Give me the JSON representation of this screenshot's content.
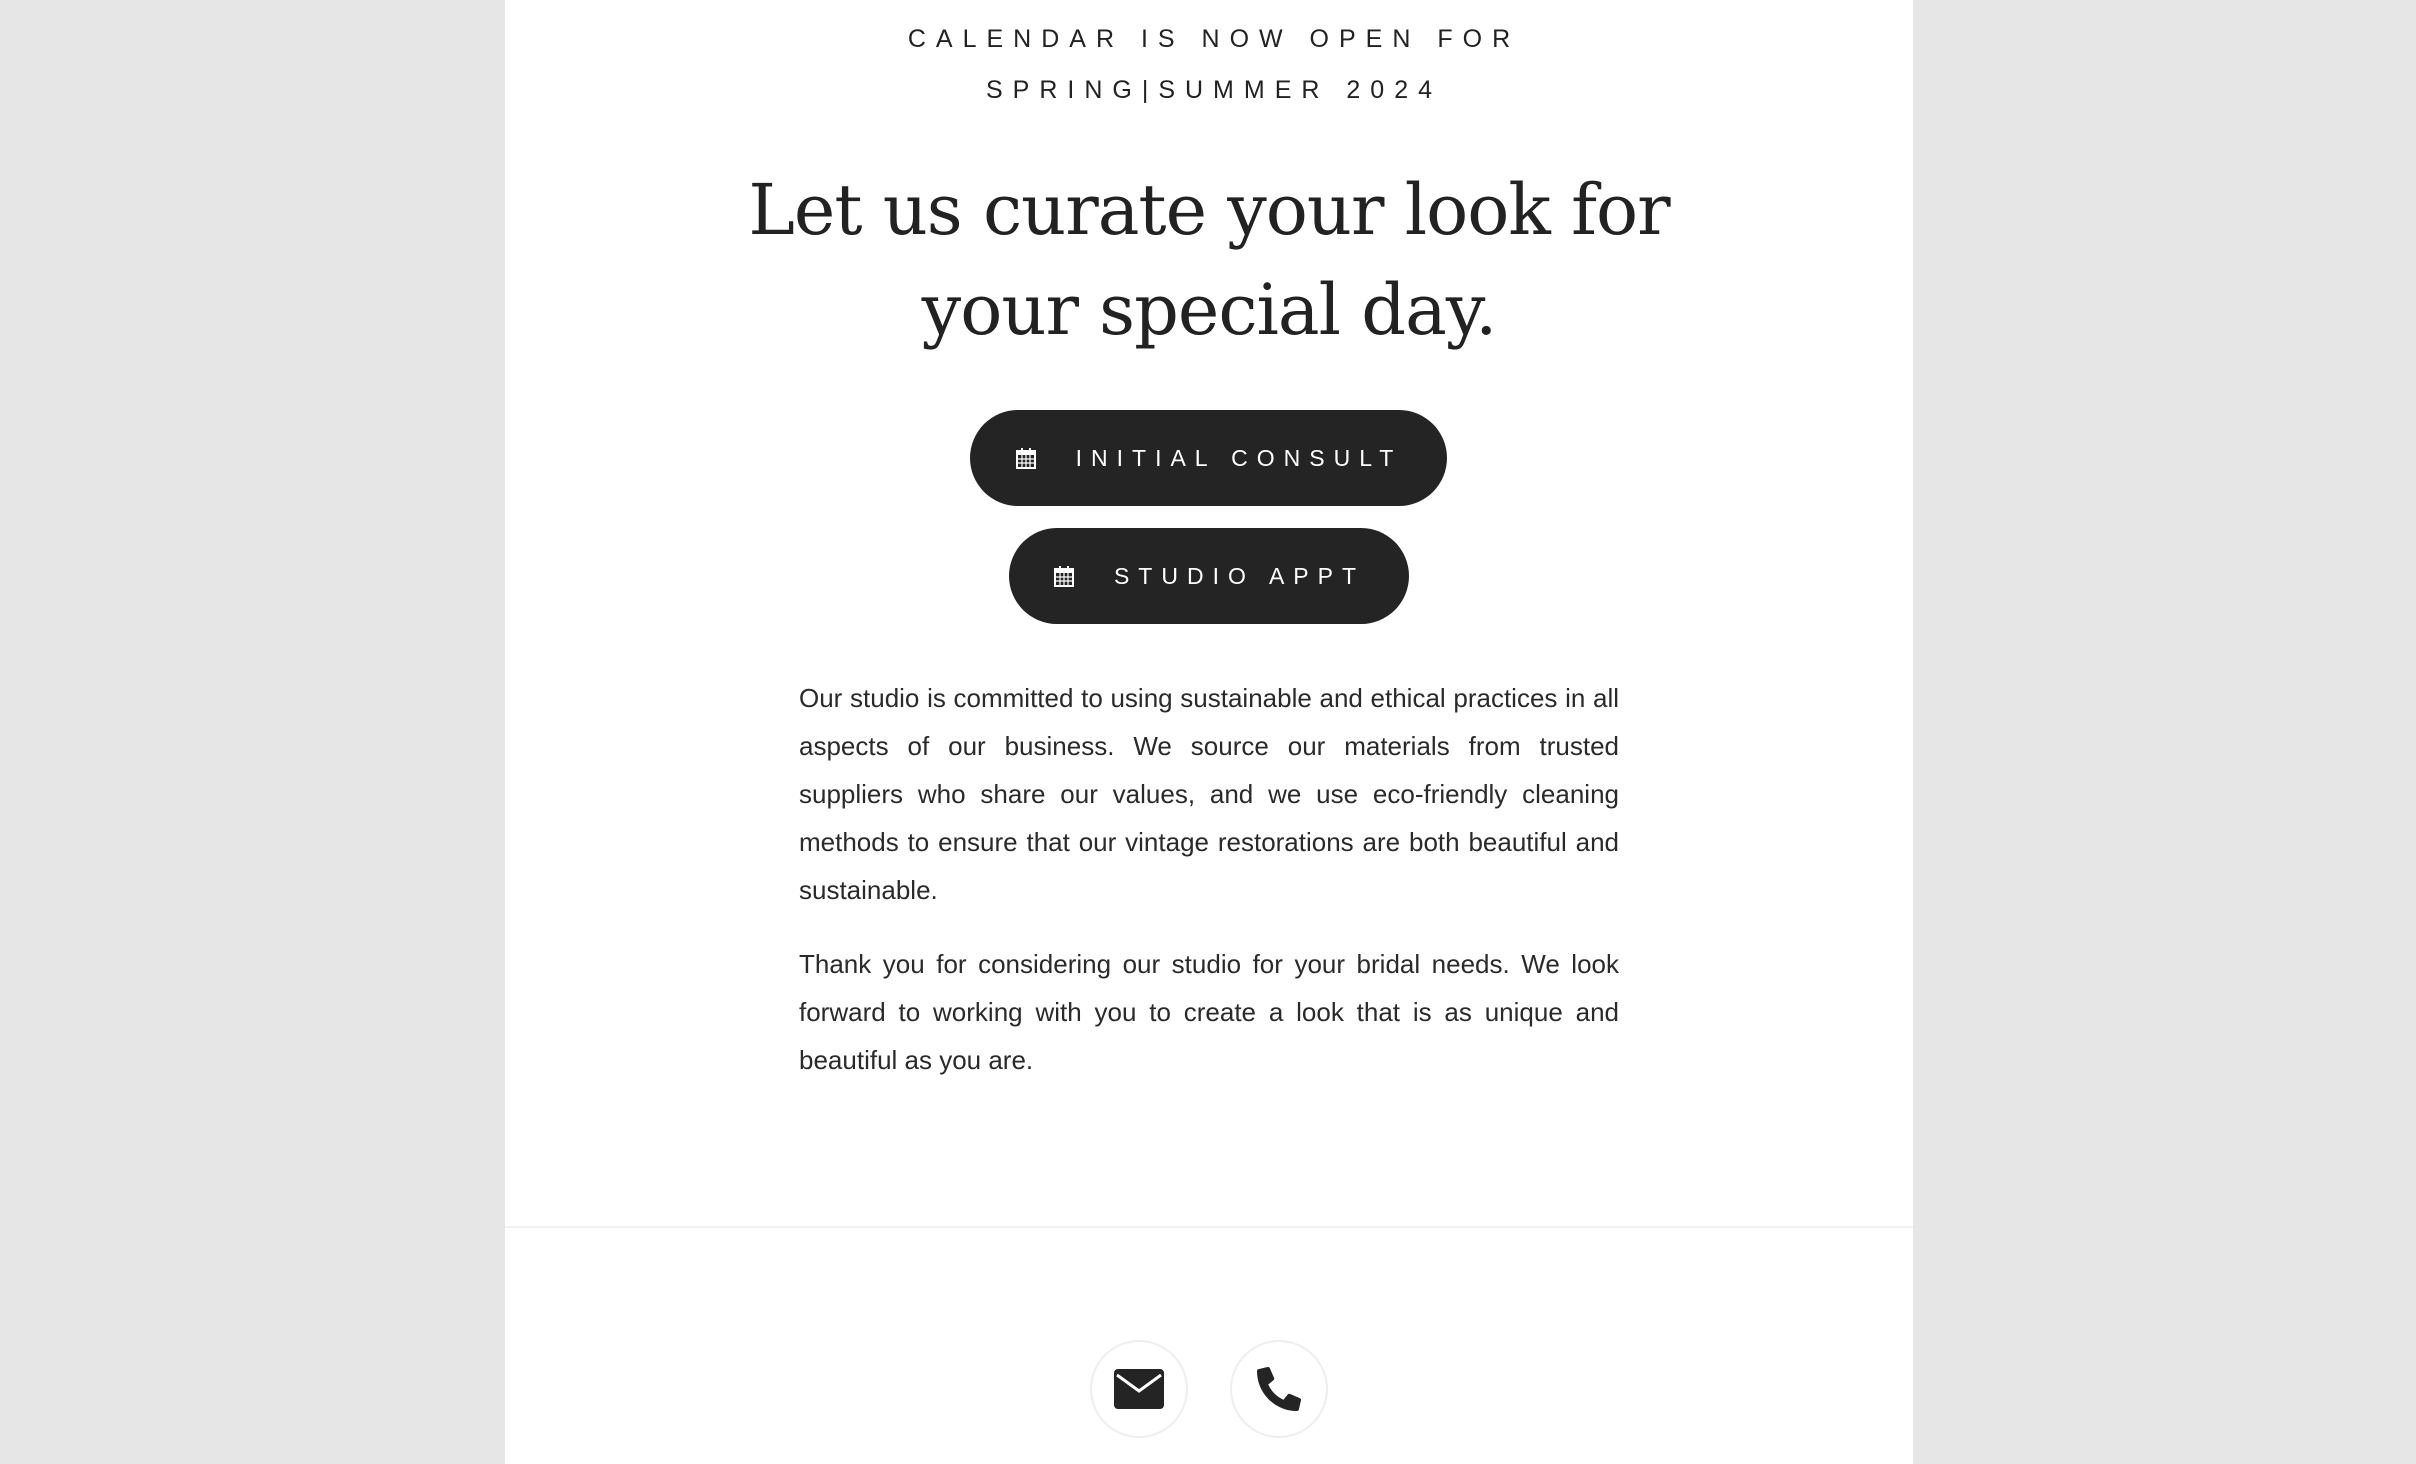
{
  "announcement": {
    "line1": "CALENDAR IS NOW OPEN FOR",
    "line2": "SPRING|SUMMER 2024"
  },
  "headline": {
    "line1": "Let us curate your look for",
    "line2": "your special day."
  },
  "buttons": {
    "consult_label": "INITIAL CONSULT",
    "studio_label": "STUDIO APPT",
    "icon": "calendar-icon"
  },
  "body": {
    "paragraph1": "Our studio is committed to using sustainable and ethical practices in all aspects of our business. We source our materials from trusted suppliers who share our values, and we use eco-friendly cleaning methods to ensure that our vintage restorations are both beautiful and sustainable.",
    "paragraph2": "Thank you for considering our studio for your bridal needs. We look forward to working with you to create a look that is as unique and beautiful as you are."
  },
  "footer": {
    "icons": [
      "envelope-icon",
      "phone-icon"
    ]
  },
  "colors": {
    "background": "#e6e6e6",
    "page": "#ffffff",
    "text": "#222222",
    "button": "#242424",
    "button_text": "#ffffff"
  }
}
